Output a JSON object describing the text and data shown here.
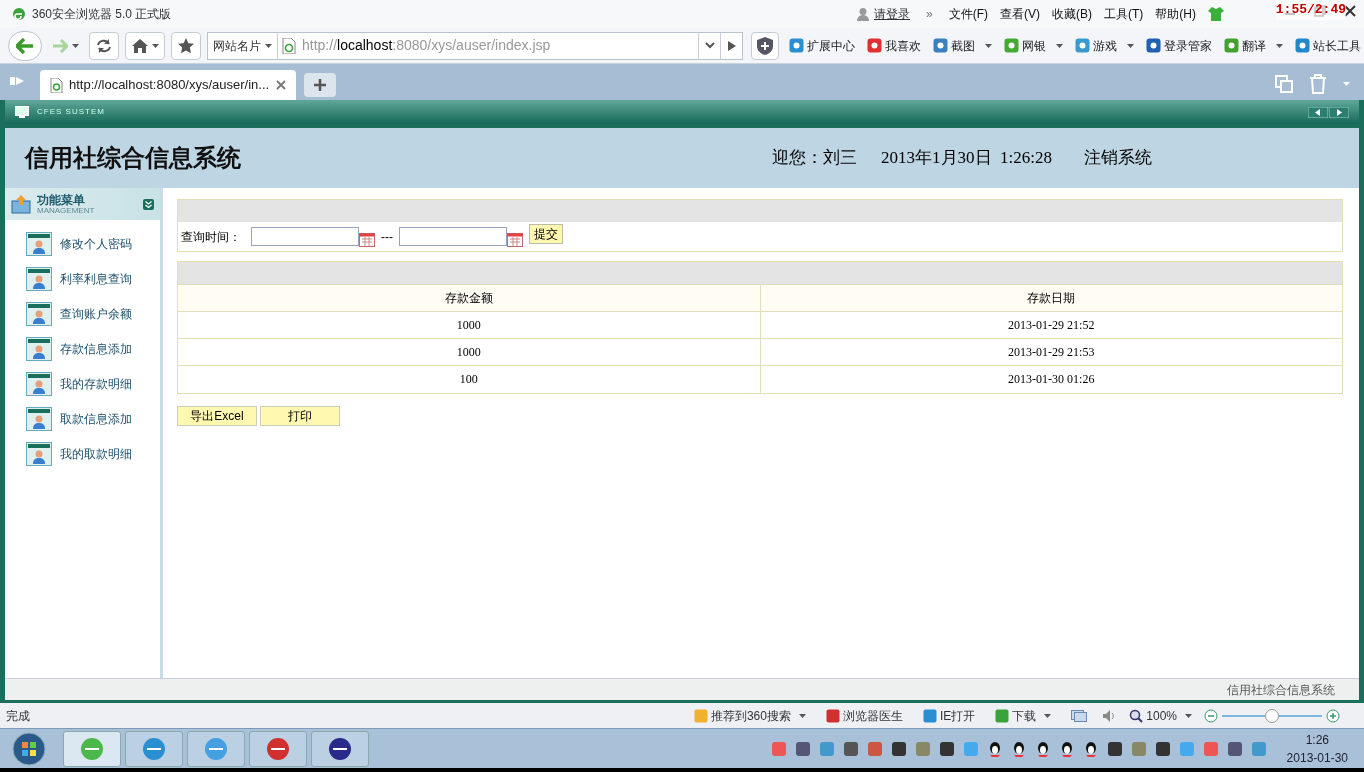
{
  "browser": {
    "title": "360安全浏览器 5.0 正式版",
    "login": "请登录",
    "more": "»",
    "menu": [
      "文件(F)",
      "查看(V)",
      "收藏(B)",
      "工具(T)",
      "帮助(H)"
    ],
    "site_card": "网站名片",
    "url": {
      "prefix": "http://",
      "host": "localhost",
      "rest": ":8080/xys/auser/index.jsp"
    },
    "toolbar": [
      {
        "label": "扩展中心",
        "dropdown": false
      },
      {
        "label": "我喜欢",
        "dropdown": false
      },
      {
        "label": "截图",
        "dropdown": true
      },
      {
        "label": "网银",
        "dropdown": true
      },
      {
        "label": "游戏",
        "dropdown": true
      },
      {
        "label": "登录管家",
        "dropdown": false
      },
      {
        "label": "翻译",
        "dropdown": true
      },
      {
        "label": "站长工具",
        "dropdown": false
      }
    ],
    "tab": {
      "title": "http://localhost:8080/xys/auser/in...",
      "selected": true
    }
  },
  "recorder_timer": "1:55/2:49",
  "app": {
    "banner": "CFES SUSTEM",
    "title": "信用社综合信息系统",
    "greeting": "迎您：刘三",
    "datetime": "2013年1月30日  1:26:28",
    "logout": "注销系统",
    "menu_title": "功能菜单",
    "menu_subtitle": "MANAGEMENT",
    "menu": [
      "修改个人密码",
      "利率利息查询",
      "查询账户余额",
      "存款信息添加",
      "我的存款明细",
      "取款信息添加",
      "我的取款明细"
    ],
    "query": {
      "label": "查询时间：",
      "separator": "---",
      "submit": "提交"
    },
    "table": {
      "columns": [
        "存款金额",
        "存款日期"
      ],
      "rows": [
        [
          "1000",
          "2013-01-29 21:52"
        ],
        [
          "1000",
          "2013-01-29 21:53"
        ],
        [
          "100",
          "2013-01-30 01:26"
        ]
      ]
    },
    "buttons": [
      "导出Excel",
      "打印"
    ],
    "footer": "信用社综合信息系统"
  },
  "status_bar": {
    "status": "完成",
    "items": [
      {
        "label": "推荐到360搜索",
        "dropdown": true
      },
      {
        "label": "浏览器医生",
        "dropdown": false
      },
      {
        "label": "IE打开",
        "dropdown": false
      },
      {
        "label": "下载",
        "dropdown": true
      }
    ],
    "zoom": "100%",
    "zoom_slider": {
      "level": 0.5
    }
  },
  "taskbar": {
    "time": "1:26",
    "date": "2013-01-30"
  }
}
